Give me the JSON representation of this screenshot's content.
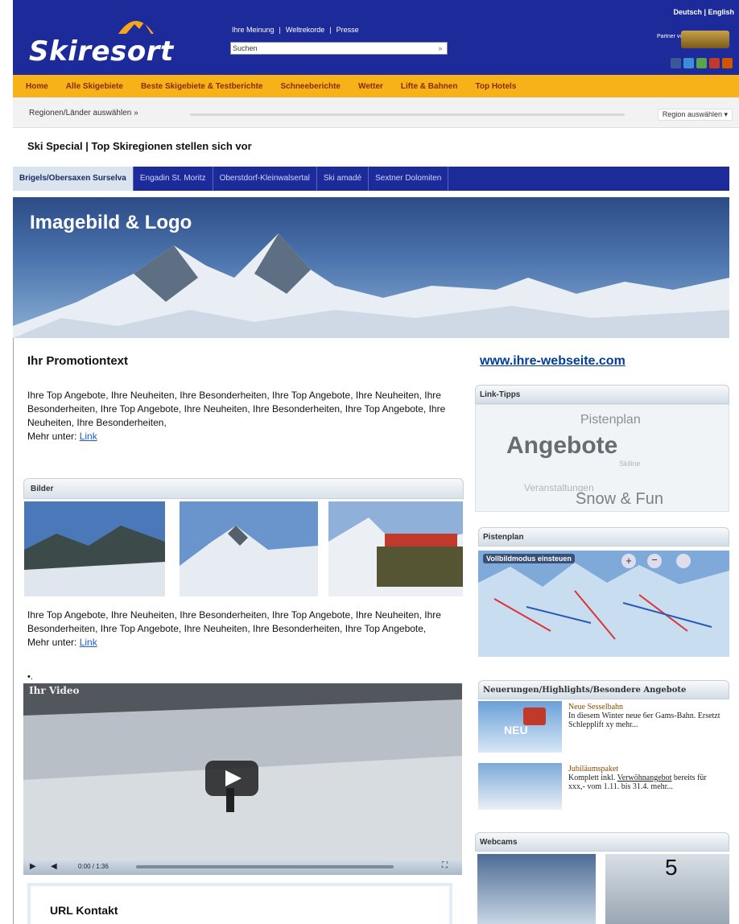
{
  "header": {
    "brand": "Skiresort",
    "top_links": [
      "Ihre Meinung",
      "Weltrekorde",
      "Presse"
    ],
    "search_placeholder": "Suchen",
    "search_go": "»",
    "languages": "Deutsch | English",
    "partner_label": "Partner von"
  },
  "nav": {
    "items": [
      "Home",
      "Alle Skigebiete",
      "Beste Skigebiete & Testberichte",
      "Schneeberichte",
      "Wetter",
      "Lifte & Bahnen",
      "Top Hotels"
    ]
  },
  "region_bar": {
    "left": "Regionen/Länder auswählen »",
    "right": "Region auswählen ▾"
  },
  "special_title": "Ski Special | Top Skiregionen stellen sich vor",
  "subtabs": [
    "Brigels/Obersaxen Surselva",
    "Engadin St. Moritz",
    "Oberstdorf-Kleinwalsertal",
    "Ski amadé",
    "Sextner Dolomiten"
  ],
  "banner": {
    "title": "Imagebild & Logo"
  },
  "promo": {
    "heading": "Ihr Promotiontext",
    "text1": "Ihre Top Angebote, Ihre Neuheiten, Ihre Besonderheiten, Ihre Top Angebote, Ihre Neuheiten, Ihre Besonderheiten, Ihre Top Angebote, Ihre Neuheiten, Ihre Besonderheiten, Ihre Top Angebote, Ihre Neuheiten, Ihre Besonderheiten,",
    "more1": "Mehr unter: ",
    "link1": "Link",
    "text2": "Ihre Top Angebote, Ihre Neuheiten, Ihre Besonderheiten, Ihre Top Angebote, Ihre Neuheiten, Ihre Besonderheiten, Ihre Top Angebote, Ihre Neuheiten, Ihre Besonderheiten, Ihre Top Angebote,",
    "more2": "Mehr unter: ",
    "link2": "Link",
    "bullet": "•."
  },
  "bilder": {
    "title": "Bilder"
  },
  "video": {
    "title": "Ihr Video",
    "time": "0:00 / 1:36"
  },
  "url_kontakt": "URL Kontakt",
  "right": {
    "website": "www.ihre-webseite.com",
    "linktips_title": "Link-Tipps",
    "tags": [
      "Pistenplan",
      "Angebote",
      "Skiline",
      "Veranstaltungen",
      "Snow & Fun"
    ],
    "pistenplan_title": "Pistenplan",
    "pistenplan_toolbar": "Vollbildmodus einsteuen",
    "news_title": "Neuerungen/Highlights/Besondere Angebote",
    "news": [
      {
        "badge": "NEU",
        "title": "Neue Sesselbahn",
        "text": "In diesem Winter neue 6er Gams-Bahn. Ersetzt Schlepplift xy",
        "more": "mehr..."
      },
      {
        "title": "Jubiläumspaket",
        "text_a": "Komplett inkl. ",
        "text_link": "Verwöhnangebot",
        "text_b": " bereits für xxx,- vom 1.11. bis 31.4.",
        "more": "mehr..."
      }
    ],
    "webcams_title": "Webcams",
    "page_number": "5"
  },
  "colors": {
    "header_blue": "#1d2a99",
    "nav_orange": "#f7b21a",
    "nav_text": "#8a2a00",
    "link_blue": "#1a5bd0"
  }
}
